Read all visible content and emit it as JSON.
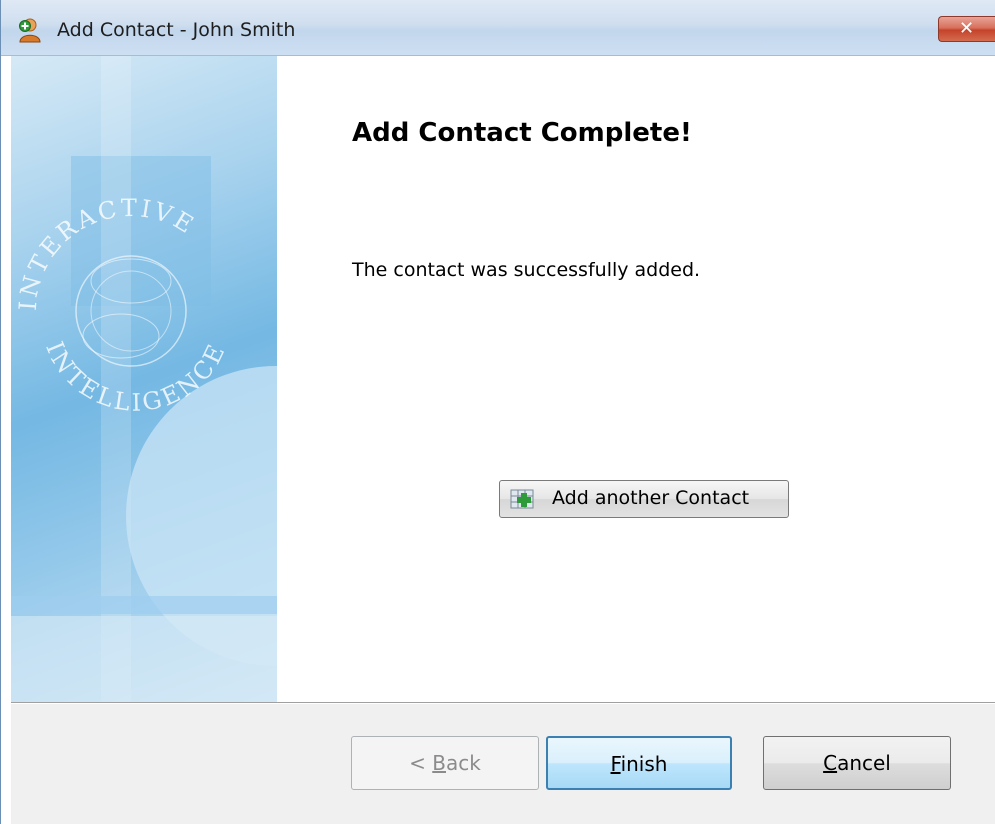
{
  "window": {
    "title": "Add Contact - John Smith",
    "close_glyph": "✕",
    "title_icon": "add-contact-icon"
  },
  "art": {
    "line1": "INTERACTIVE",
    "line2": "INTELLIGENCE"
  },
  "content": {
    "heading": "Add Contact Complete!",
    "message": "The contact was successfully added.",
    "add_another_label": "Add another Contact",
    "add_another_icon": "add-contact-grid-icon"
  },
  "footer": {
    "back_prefix": "< ",
    "back_mnemonic": "B",
    "back_rest": "ack",
    "finish_mnemonic": "F",
    "finish_rest": "inish",
    "cancel_mnemonic": "C",
    "cancel_rest": "ancel"
  },
  "colors": {
    "title_bar": "#cfdeef",
    "close_button": "#c4432a",
    "art_blue": "#74b8e3",
    "footer_bg": "#f0f0f0",
    "default_button_border": "#3c7fb1"
  }
}
